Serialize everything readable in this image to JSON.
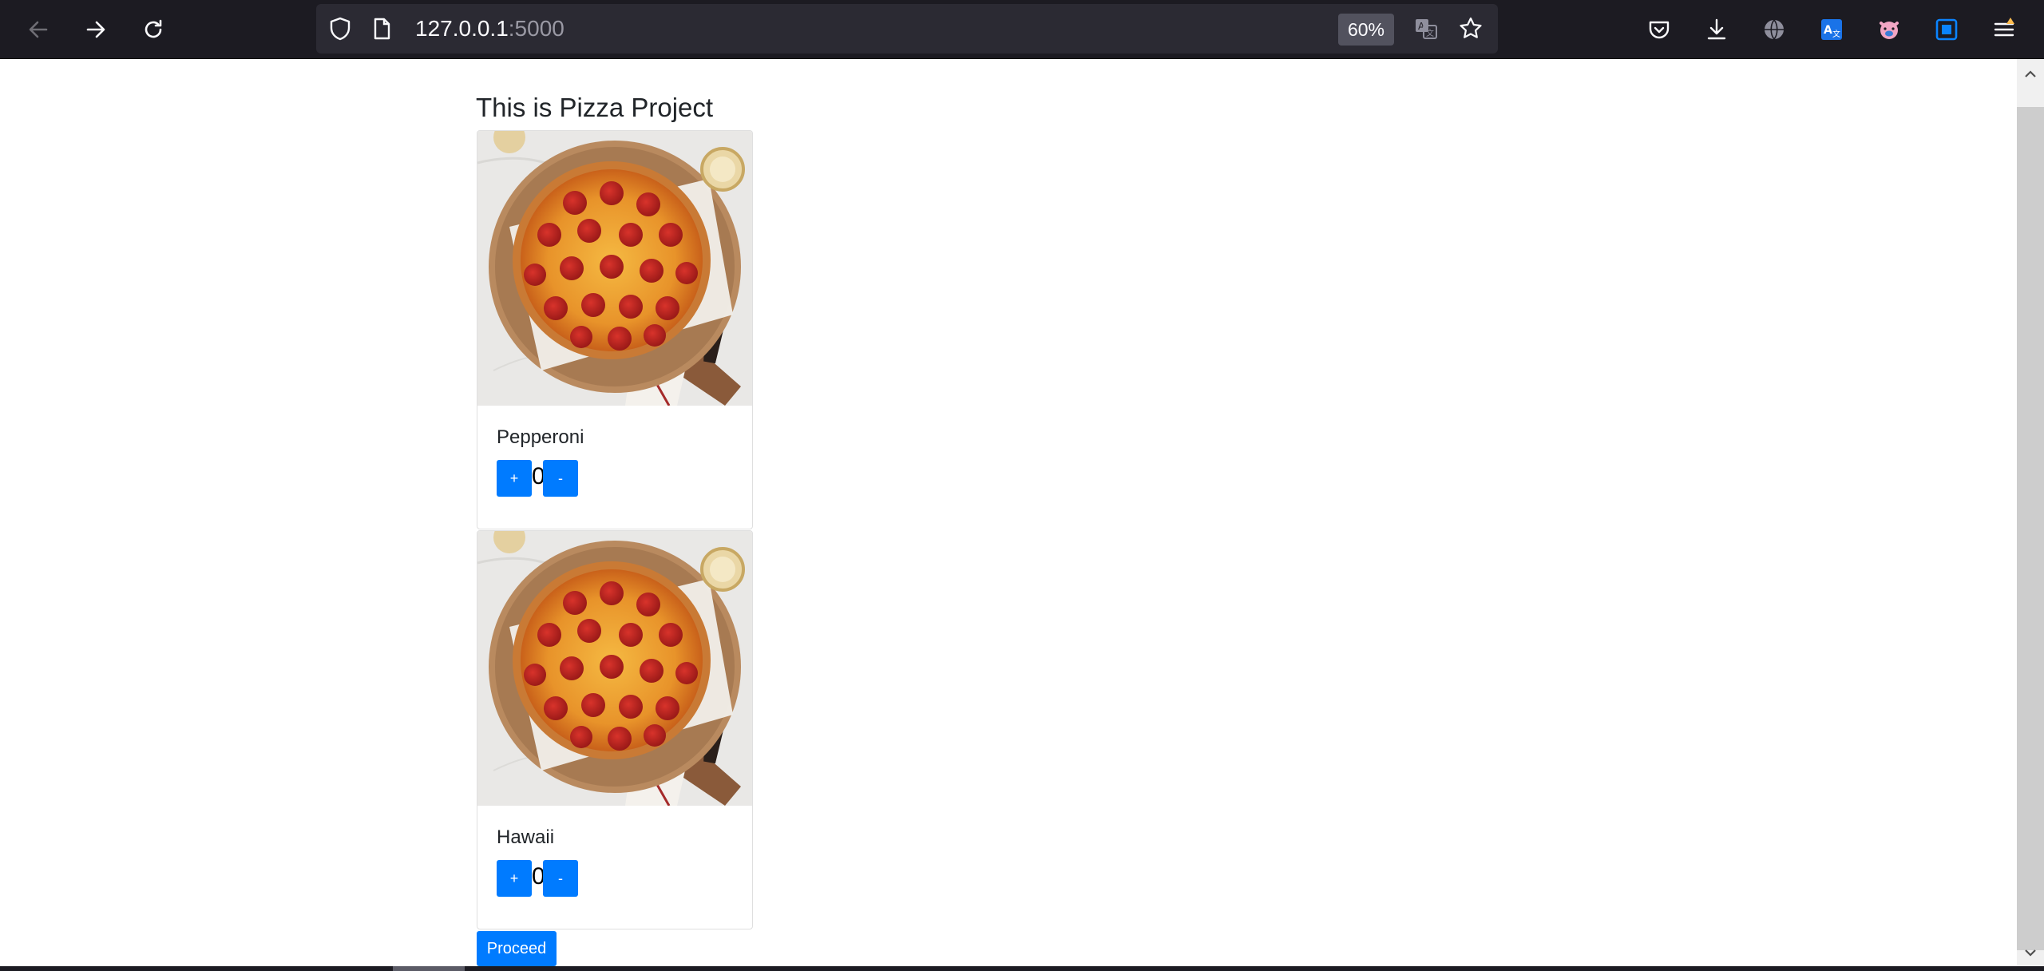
{
  "browser": {
    "url_host": "127.0.0.1",
    "url_port": ":5000",
    "zoom_level": "60%",
    "icons": {
      "back": "back-arrow-icon",
      "forward": "forward-arrow-icon",
      "reload": "reload-icon",
      "tracking": "shield-icon",
      "page": "page-icon",
      "translate": "translate-icon",
      "bookmark": "star-icon",
      "pocket": "pocket-icon",
      "downloads": "download-icon",
      "extensions": [
        "globe-icon",
        "translate-extension-icon",
        "pig-extension-icon",
        "screenshot-icon"
      ],
      "menu": "hamburger-menu-icon"
    }
  },
  "page": {
    "title": "This is Pizza Project",
    "products": [
      {
        "name": "Pepperoni",
        "image": "pepperoni-pizza-image",
        "increment_label": "+",
        "quantity": "0",
        "decrement_label": "-"
      },
      {
        "name": "Hawaii",
        "image": "pepperoni-pizza-image",
        "increment_label": "+",
        "quantity": "0",
        "decrement_label": "-"
      }
    ],
    "proceed_label": "Proceed"
  },
  "colors": {
    "primary_button": "#007bff",
    "toolbar_bg": "#1c1b22",
    "urlbar_bg": "#2b2a33"
  }
}
